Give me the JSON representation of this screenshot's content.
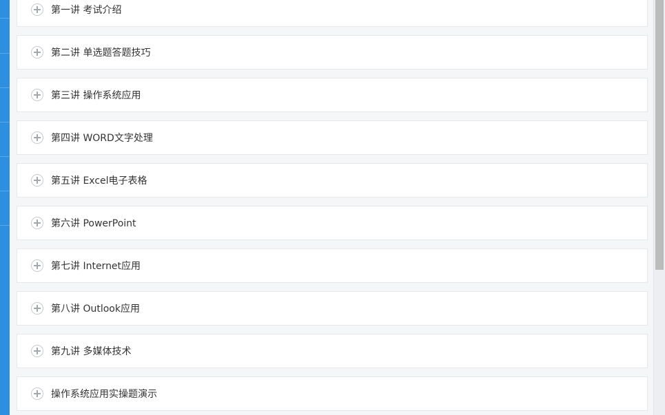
{
  "chapters": [
    {
      "title": "第一讲 考试介绍"
    },
    {
      "title": "第二讲 单选题答题技巧"
    },
    {
      "title": "第三讲 操作系统应用"
    },
    {
      "title": "第四讲 WORD文字处理"
    },
    {
      "title": "第五讲 Excel电子表格"
    },
    {
      "title": "第六讲 PowerPoint"
    },
    {
      "title": "第七讲 Internet应用"
    },
    {
      "title": "第八讲 Outlook应用"
    },
    {
      "title": "第九讲 多媒体技术"
    },
    {
      "title": "操作系统应用实操题演示"
    }
  ],
  "icons": {
    "expand": "plus-circle-icon"
  },
  "colors": {
    "accent": "#2d8fdf",
    "background": "#f5f6f8",
    "card": "#ffffff",
    "text": "#333333"
  }
}
